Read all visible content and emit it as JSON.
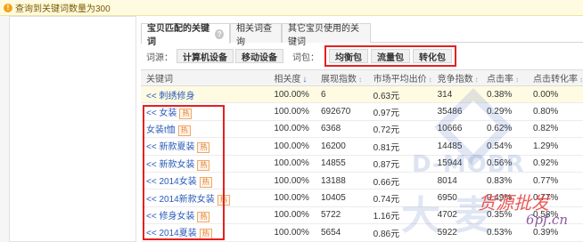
{
  "notice": {
    "text": "查询到关键词数量为300"
  },
  "tabs": [
    {
      "label": "宝贝匹配的关键词",
      "active": true
    },
    {
      "label": "相关词查询",
      "active": false
    },
    {
      "label": "其它宝贝使用的关键词",
      "active": false
    }
  ],
  "filter": {
    "source_label": "词源：",
    "source_buttons": [
      "计算机设备",
      "移动设备"
    ],
    "package_label": "词包：",
    "package_buttons": [
      "均衡包",
      "流量包",
      "转化包"
    ]
  },
  "table": {
    "headers": [
      "关键词",
      "相关度",
      "展现指数",
      "市场平均出价",
      "竞争指数",
      "点击率",
      "点击转化率"
    ],
    "sort_marks": [
      "",
      "↓",
      "↕",
      "↕",
      "↕",
      "↕",
      "↕"
    ],
    "rows": [
      {
        "keyword": "<< 刺绣修身",
        "tag": "",
        "relevance": "100.00%",
        "impressions": "6",
        "avg_bid": "0.63元",
        "competition": "314",
        "ctr": "0.38%",
        "cvr": "0.00%"
      },
      {
        "keyword": "<< 女装",
        "tag": "热",
        "relevance": "100.00%",
        "impressions": "692670",
        "avg_bid": "0.97元",
        "competition": "35486",
        "ctr": "0.29%",
        "cvr": "0.80%"
      },
      {
        "keyword": "女装t恤",
        "tag": "热",
        "relevance": "100.00%",
        "impressions": "6368",
        "avg_bid": "0.72元",
        "competition": "10666",
        "ctr": "0.62%",
        "cvr": "0.82%"
      },
      {
        "keyword": "<< 新款夏装",
        "tag": "热",
        "relevance": "100.00%",
        "impressions": "16200",
        "avg_bid": "0.81元",
        "competition": "14485",
        "ctr": "0.54%",
        "cvr": "1.29%"
      },
      {
        "keyword": "<< 新款女装",
        "tag": "热",
        "relevance": "100.00%",
        "impressions": "14855",
        "avg_bid": "0.87元",
        "competition": "15944",
        "ctr": "0.56%",
        "cvr": "0.92%"
      },
      {
        "keyword": "<< 2014女装",
        "tag": "热",
        "relevance": "100.00%",
        "impressions": "13188",
        "avg_bid": "0.66元",
        "competition": "8014",
        "ctr": "0.83%",
        "cvr": "0.77%"
      },
      {
        "keyword": "<< 2014新款女装",
        "tag": "热",
        "relevance": "100.00%",
        "impressions": "10405",
        "avg_bid": "0.74元",
        "competition": "6950",
        "ctr": "0.49%",
        "cvr": "0.77%"
      },
      {
        "keyword": "<< 修身女装",
        "tag": "热",
        "relevance": "100.00%",
        "impressions": "5722",
        "avg_bid": "1.16元",
        "competition": "4702",
        "ctr": "0.35%",
        "cvr": "0.58%"
      },
      {
        "keyword": "<< 2014夏装",
        "tag": "热",
        "relevance": "100.00%",
        "impressions": "5654",
        "avg_bid": "0.86元",
        "competition": "5922",
        "ctr": "0.53%",
        "cvr": "0.39%"
      }
    ]
  },
  "watermark": {
    "latin": "D-MOBR",
    "cjk": "大 麦",
    "brand_cn": "货源批发",
    "brand_url": "6pf.cn"
  },
  "colors": {
    "highlight_row": "#fffbe3",
    "annotation_red": "#e52020",
    "link_blue": "#2a5bb8"
  }
}
